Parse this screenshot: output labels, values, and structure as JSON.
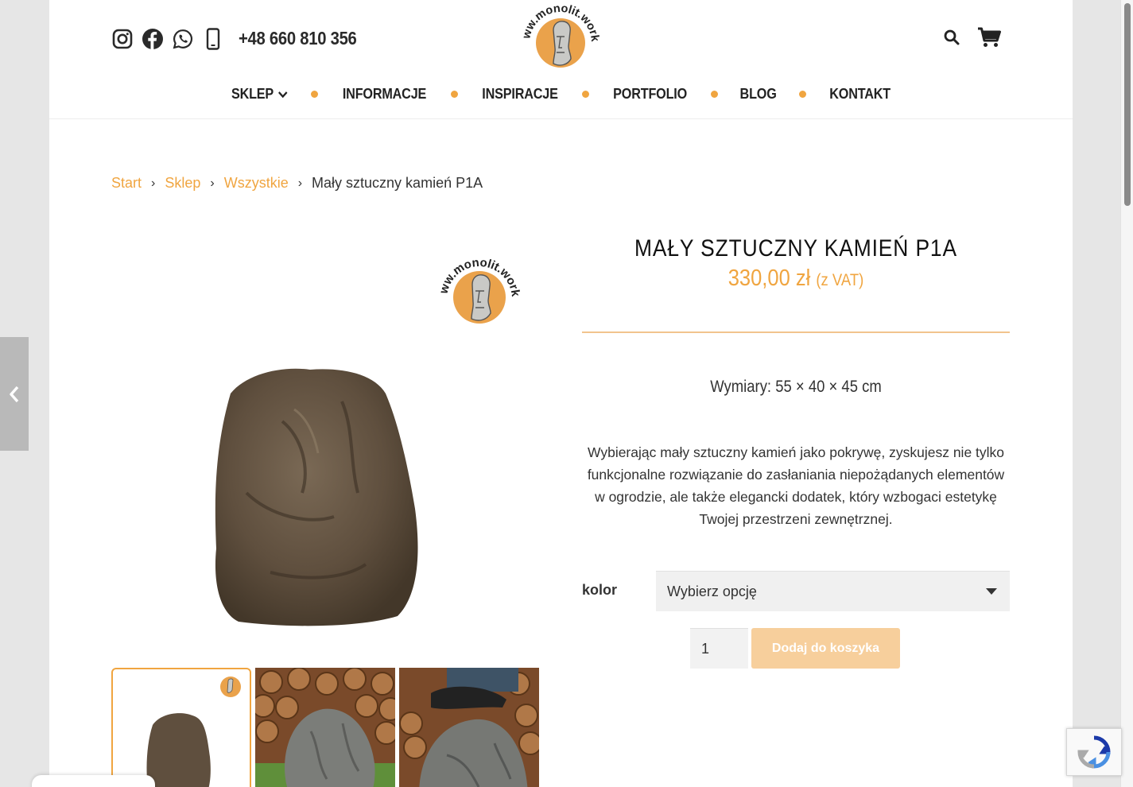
{
  "header": {
    "phone": "+48 660 810 356",
    "logo_text": "www.monolit.works",
    "social_icons": [
      "instagram-icon",
      "facebook-icon",
      "whatsapp-icon",
      "mobile-phone-icon"
    ],
    "tool_icons": [
      "search-icon",
      "cart-icon"
    ]
  },
  "nav": {
    "items": [
      {
        "label": "SKLEP",
        "has_dropdown": true
      },
      {
        "label": "INFORMACJE"
      },
      {
        "label": "INSPIRACJE"
      },
      {
        "label": "PORTFOLIO"
      },
      {
        "label": "BLOG"
      },
      {
        "label": "KONTAKT"
      }
    ]
  },
  "breadcrumb": {
    "items": [
      "Start",
      "Sklep",
      "Wszystkie"
    ],
    "current": "Mały sztuczny kamień P1A"
  },
  "product": {
    "title": "MAŁY SZTUCZNY KAMIEŃ P1A",
    "price": "330,00 zł",
    "vat_note": "(z VAT)",
    "dimensions": "Wymiary: 55 × 40 × 45 cm",
    "description": "Wybierając mały sztuczny kamień jako pokrywę, zyskujesz nie tylko funkcjonalne rozwiązanie do zasłaniania niepożądanych elementów w ogrodzie, ale także elegancki dodatek, który wzbogaci estetykę Twojej przestrzeni zewnętrznej.",
    "variation_label": "kolor",
    "variation_value": "Wybierz opcję",
    "quantity": "1",
    "add_to_cart": "Dodaj do koszyka"
  },
  "colors": {
    "accent": "#f0a540",
    "button_disabled": "#f7cf9c",
    "rock_brown": "#6b5a47",
    "rock_gray": "#8a8a86"
  }
}
